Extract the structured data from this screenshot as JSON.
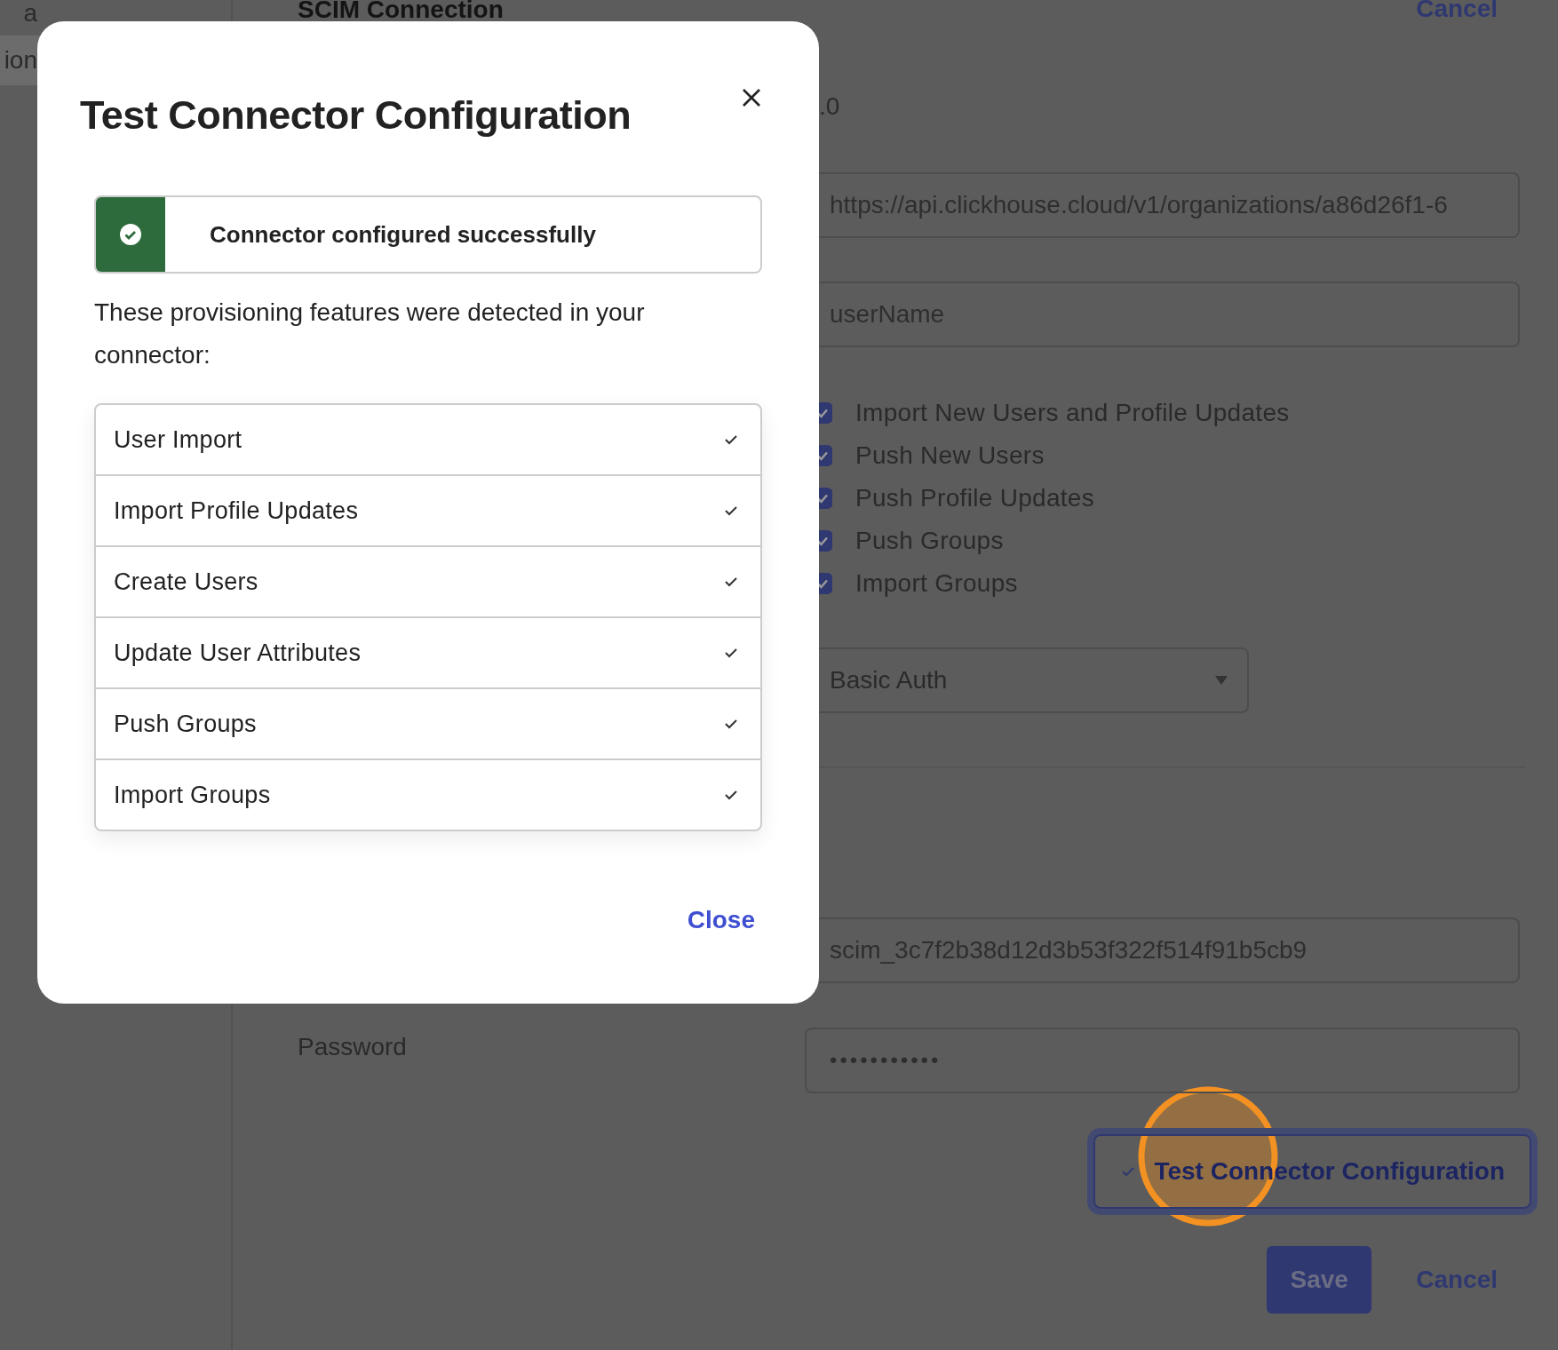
{
  "sidebar": {
    "items": [
      {
        "label": "a",
        "selected": false
      },
      {
        "label": "ion",
        "selected": true
      }
    ]
  },
  "page": {
    "title": "SCIM Connection",
    "header_action": "Cancel",
    "version_value": ".0",
    "base_url": "https://api.clickhouse.cloud/v1/organizations/a86d26f1-6",
    "unique_identifier": "userName",
    "features": [
      {
        "label": "Import New Users and Profile Updates",
        "checked": true
      },
      {
        "label": "Push New Users",
        "checked": true
      },
      {
        "label": "Push Profile Updates",
        "checked": true
      },
      {
        "label": "Push Groups",
        "checked": true
      },
      {
        "label": "Import Groups",
        "checked": true
      }
    ],
    "auth_mode": "Basic Auth",
    "username": "scim_3c7f2b38d12d3b53f322f514f91b5cb9",
    "password_label": "Password",
    "password_value": "•••••••••••",
    "test_button": {
      "label": "Test Connector Configuration",
      "verified": true
    },
    "save_button": "Save",
    "cancel_button": "Cancel"
  },
  "modal": {
    "title": "Test Connector Configuration",
    "banner": {
      "kind": "success",
      "message": "Connector configured successfully"
    },
    "intro": "These provisioning features were detected in your connector:",
    "features": [
      {
        "label": "User Import",
        "detected": true
      },
      {
        "label": "Import Profile Updates",
        "detected": true
      },
      {
        "label": "Create Users",
        "detected": true
      },
      {
        "label": "Update User Attributes",
        "detected": true
      },
      {
        "label": "Push Groups",
        "detected": true
      },
      {
        "label": "Import Groups",
        "detected": true
      }
    ],
    "close_link": "Close"
  }
}
